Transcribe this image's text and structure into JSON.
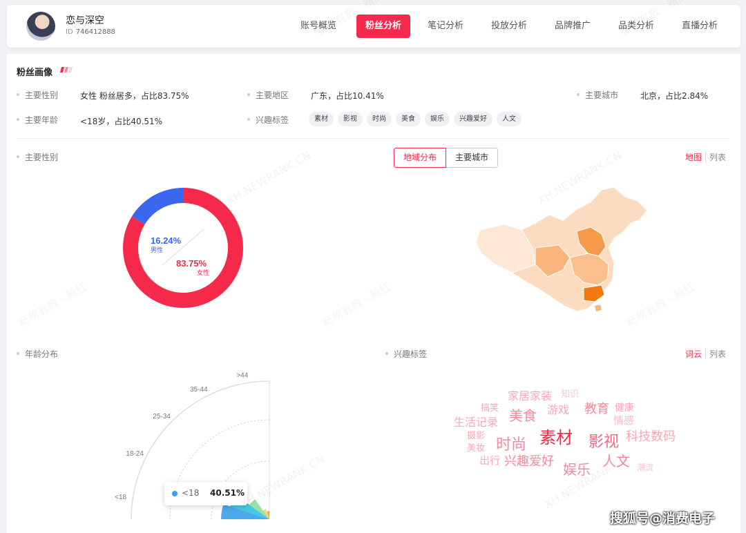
{
  "profile": {
    "name": "恋与深空",
    "id_label": "ID",
    "id_value": "746412888"
  },
  "nav": {
    "tabs": [
      "账号概览",
      "粉丝分析",
      "笔记分析",
      "投放分析",
      "品牌推广",
      "品类分析",
      "直播分析"
    ],
    "active_index": 1
  },
  "section_title": "粉丝画像",
  "summary": {
    "gender_label": "主要性别",
    "gender_value": "女性 粉丝居多，占比83.75%",
    "region_label": "主要地区",
    "region_value": "广东，占比10.41%",
    "city_label": "主要城市",
    "city_value": "北京，占比2.84%",
    "age_label": "主要年龄",
    "age_value": "<18岁，占比40.51%",
    "interest_label": "兴趣标签",
    "interest_tags": [
      "素材",
      "影视",
      "时尚",
      "美食",
      "娱乐",
      "兴趣爱好",
      "人文"
    ]
  },
  "gender_chart": {
    "label": "主要性别",
    "male_pct": "16.24%",
    "male_text": "男性",
    "female_pct": "83.75%",
    "female_text": "女性"
  },
  "region_panel": {
    "tab_region": "地域分布",
    "tab_city": "主要城市",
    "view_map": "地图",
    "view_list": "列表"
  },
  "age_panel": {
    "label": "年龄分布",
    "tooltip_label": "<18",
    "tooltip_value": "40.51%"
  },
  "interest_panel": {
    "label": "兴趣标签",
    "view_cloud": "词云",
    "view_list": "列表",
    "words": [
      "家居家装",
      "知识",
      "搞笑",
      "游戏",
      "教育",
      "健康",
      "美食",
      "生活记录",
      "情感",
      "摄影",
      "素材",
      "影视",
      "科技数码",
      "美妆",
      "时尚",
      "出行",
      "兴趣爱好",
      "人文",
      "娱乐",
      "潮流"
    ]
  },
  "watermarks": {
    "brand_cn": "新榜有数 · 新红",
    "brand_en": "XH.NEWRANK.CN",
    "footer": "搜狐号@消费电子"
  },
  "chart_data": [
    {
      "type": "pie",
      "title": "主要性别",
      "categories": [
        "男性",
        "女性"
      ],
      "values": [
        16.24,
        83.75
      ],
      "colors": [
        "#3b67f0",
        "#f5294a"
      ]
    },
    {
      "type": "area",
      "title": "年龄分布",
      "categories": [
        "<18",
        "18-24",
        "25-34",
        "35-44",
        ">44"
      ],
      "values": [
        40.51,
        34,
        18,
        5,
        2.5
      ],
      "colors": [
        "#3aa0e8",
        "#33c3dc",
        "#8fdc9e",
        "#f7d35a",
        "#f59a4b"
      ]
    }
  ],
  "colors": {
    "accent": "#f5294a",
    "male": "#3b67f0",
    "female": "#f5294a"
  }
}
